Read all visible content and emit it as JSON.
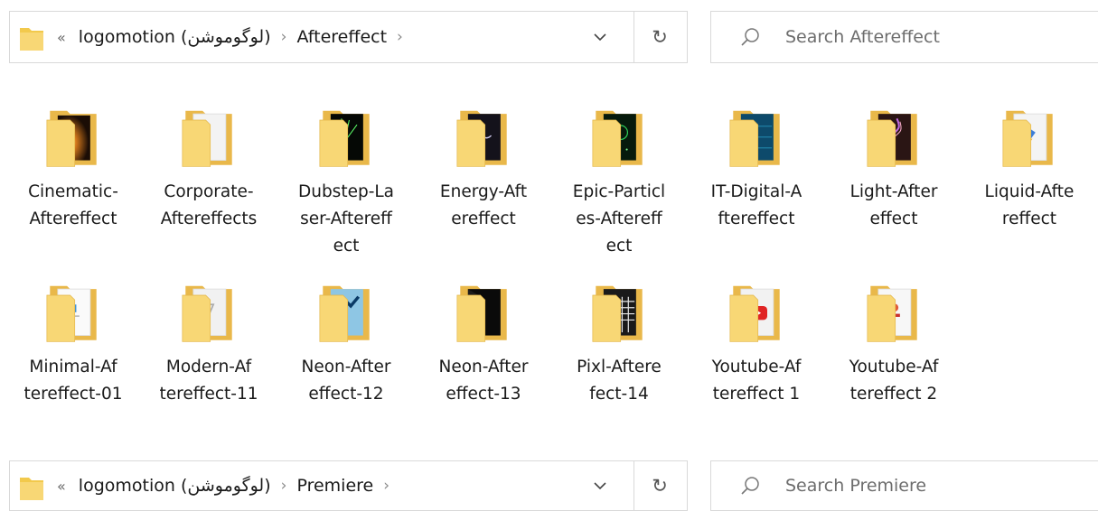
{
  "top_bar": {
    "crumbs": [
      "logomotion (لوگوموشن)",
      "Aftereffect"
    ],
    "search_placeholder": "Search Aftereffect"
  },
  "bottom_bar": {
    "crumbs": [
      "logomotion (لوگوموشن)",
      "Premiere"
    ],
    "search_placeholder": "Search Premiere"
  },
  "folders": [
    {
      "label": "Cinematic-\nAftereffect",
      "thumb": "fiery-light"
    },
    {
      "label": "Corporate-\nAftereffects",
      "thumb": "pdf-page"
    },
    {
      "label": "Dubstep-La\nser-Aftereff\nect",
      "thumb": "green-laser"
    },
    {
      "label": "Energy-Aft\nereffect",
      "thumb": "dark-text"
    },
    {
      "label": "Epic-Particl\nes-Aftereff\nect",
      "thumb": "green-particles"
    },
    {
      "label": "IT-Digital-A\nftereffect",
      "thumb": "blue-digital"
    },
    {
      "label": "Light-After\neffect",
      "thumb": "light-streak"
    },
    {
      "label": "Liquid-Afte\nreffect",
      "thumb": "colorful-logo"
    },
    {
      "label": "Minimal-Af\ntereffect-01",
      "thumb": "minimal-logo"
    },
    {
      "label": "Modern-Af\ntereffect-11",
      "thumb": "modern-logo"
    },
    {
      "label": "Neon-After\neffect-12",
      "thumb": "neon-blue"
    },
    {
      "label": "Neon-After\neffect-13",
      "thumb": "neon-dark"
    },
    {
      "label": "Pixl-Aftere\nfect-14",
      "thumb": "keyboard"
    },
    {
      "label": "Youtube-Af\ntereffect 1",
      "thumb": "youtube-red"
    },
    {
      "label": "Youtube-Af\ntereffect 2",
      "thumb": "youtube-logo"
    }
  ]
}
